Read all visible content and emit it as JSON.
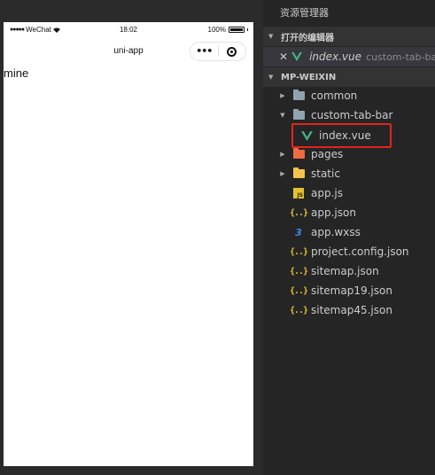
{
  "simulator": {
    "status_bar": {
      "carrier": "WeChat",
      "time": "18:02",
      "battery": "100%"
    },
    "nav_title": "uni-app",
    "capsule_more": "•••",
    "page_text": "mine"
  },
  "explorer": {
    "title": "资源管理器",
    "open_editors": {
      "header": "打开的编辑器",
      "items": [
        {
          "close": "✕",
          "name": "index.vue",
          "path": "custom-tab-bar"
        }
      ]
    },
    "project": {
      "header": "MP-WEIXIN",
      "tree": [
        {
          "name": "common"
        },
        {
          "name": "custom-tab-bar"
        },
        {
          "name": "index.vue"
        },
        {
          "name": "pages"
        },
        {
          "name": "static"
        },
        {
          "name": "app.js",
          "js_label": "JS"
        },
        {
          "name": "app.json",
          "glyph": "{..}"
        },
        {
          "name": "app.wxss",
          "glyph": "3"
        },
        {
          "name": "project.config.json",
          "glyph": "{..}"
        },
        {
          "name": "sitemap.json",
          "glyph": "{..}"
        },
        {
          "name": "sitemap19.json",
          "glyph": "{..}"
        },
        {
          "name": "sitemap45.json",
          "glyph": "{..}"
        }
      ]
    }
  },
  "colors": {
    "highlight_border": "#e1251b",
    "vue_green": "#41b883",
    "folder_gray": "#90a4ae",
    "pages_orange": "#ef6c42",
    "static_yellow": "#f2c44b"
  }
}
